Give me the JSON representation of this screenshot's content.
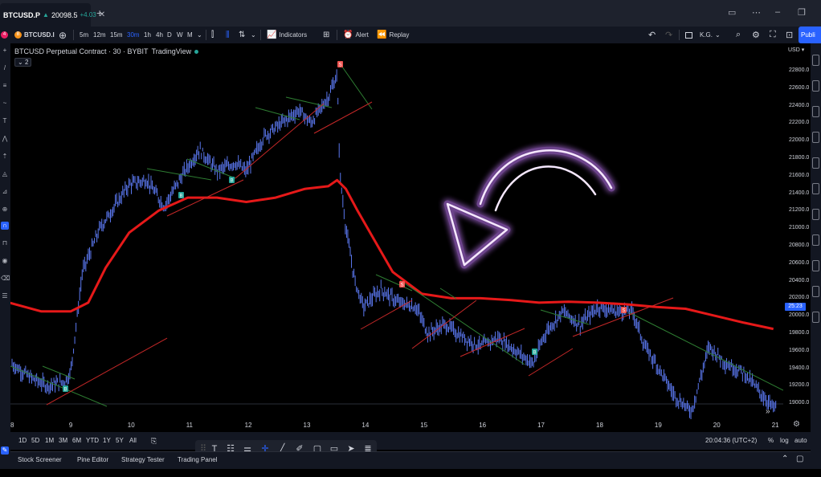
{
  "tab": {
    "symbol": "BTCUSD.P",
    "arrow": "▲",
    "price": "20098.5",
    "change": "+4.03",
    "close": "✕"
  },
  "toolbar": {
    "symbol": "BTCUSD.I",
    "intervals": [
      "5m",
      "12m",
      "15m",
      "30m",
      "1h",
      "4h",
      "D",
      "W",
      "M"
    ],
    "active_interval": "30m",
    "indicators": "Indicators",
    "alert": "Alert",
    "replay": "Replay",
    "layout": "K.G.",
    "publish": "Publi"
  },
  "legend": {
    "title": "BTCUSD Perpetual Contract · 30 · BYBIT",
    "source": "TradingView",
    "indicator_count": "2"
  },
  "price_scale": {
    "currency": "USD",
    "labels": [
      "22800.0",
      "22600.0",
      "22400.0",
      "22200.0",
      "22000.0",
      "21800.0",
      "21600.0",
      "21400.0",
      "21200.0",
      "21000.0",
      "20800.0",
      "20600.0",
      "20400.0",
      "20200.0",
      "20000.0",
      "19800.0",
      "19600.0",
      "19400.0",
      "19200.0",
      "19000.0"
    ],
    "current_price_box": "25:23"
  },
  "time_axis": {
    "labels": [
      "8",
      "9",
      "10",
      "11",
      "12",
      "13",
      "14",
      "15",
      "16",
      "17",
      "18",
      "19",
      "20",
      "21"
    ]
  },
  "bottom_bar": {
    "ranges": [
      "1D",
      "5D",
      "1M",
      "3M",
      "6M",
      "YTD",
      "1Y",
      "5Y",
      "All"
    ],
    "clock": "20:04:36 (UTC+2)",
    "pct": "%",
    "log": "log",
    "auto": "auto"
  },
  "footer": {
    "tabs": [
      "Stock Screener",
      "Pine Editor",
      "Strategy Tester",
      "Trading Panel"
    ]
  },
  "chart_data": {
    "type": "line",
    "title": "BTCUSD Perpetual Contract · 30 · BYBIT",
    "xlabel": "",
    "ylabel": "",
    "x_ticks": [
      "8",
      "9",
      "10",
      "11",
      "12",
      "13",
      "14",
      "15",
      "16",
      "17",
      "18",
      "19",
      "20",
      "21"
    ],
    "ylim": [
      18900,
      22950
    ],
    "series": [
      {
        "color": "#5b78f0",
        "x": [
          8.0,
          8.3,
          8.6,
          8.9,
          9.0,
          9.2,
          9.5,
          9.8,
          10.0,
          10.3,
          10.6,
          10.9,
          11.2,
          11.5,
          11.8,
          12.0,
          12.3,
          12.6,
          12.9,
          13.1,
          13.4,
          13.55,
          13.6,
          13.7,
          13.85,
          14.0,
          14.3,
          14.6,
          14.9,
          15.1,
          15.4,
          15.7,
          16.0,
          16.3,
          16.6,
          16.9,
          17.1,
          17.4,
          17.7,
          18.0,
          18.3,
          18.6,
          18.8,
          19.0,
          19.3,
          19.6,
          19.9,
          20.2,
          20.5,
          20.8,
          21.0
        ],
        "y": [
          19450,
          19300,
          19200,
          19250,
          19350,
          20500,
          21000,
          21300,
          21500,
          21550,
          21250,
          21600,
          21900,
          21650,
          21750,
          21650,
          22050,
          22200,
          22350,
          22200,
          22500,
          22750,
          21600,
          21000,
          20400,
          20100,
          20300,
          20150,
          20100,
          19800,
          19900,
          19750,
          19650,
          19750,
          19600,
          19450,
          19800,
          20050,
          19900,
          20100,
          20050,
          20050,
          19650,
          19450,
          19100,
          18900,
          19650,
          19450,
          19350,
          19100,
          18950
        ]
      },
      {
        "color": "#e61919",
        "name": "",
        "x": [
          7.95,
          8.5,
          9.0,
          9.3,
          9.6,
          10.0,
          10.5,
          11.0,
          11.5,
          12.0,
          12.5,
          13.0,
          13.4,
          13.55,
          13.7,
          13.9,
          14.2,
          14.5,
          15.0,
          15.5,
          16.0,
          16.5,
          17.0,
          17.5,
          18.0,
          18.5,
          19.0,
          19.5,
          20.0,
          20.5,
          21.0
        ],
        "y": [
          20150,
          20050,
          20050,
          20150,
          20550,
          20950,
          21200,
          21350,
          21350,
          21300,
          21350,
          21450,
          21480,
          21550,
          21450,
          21200,
          20850,
          20500,
          20250,
          20200,
          20200,
          20180,
          20150,
          20160,
          20150,
          20130,
          20100,
          20080,
          20000,
          19920,
          19850
        ]
      }
    ],
    "annotations": [
      "B",
      "B",
      "B",
      "S",
      "S",
      "S"
    ]
  }
}
